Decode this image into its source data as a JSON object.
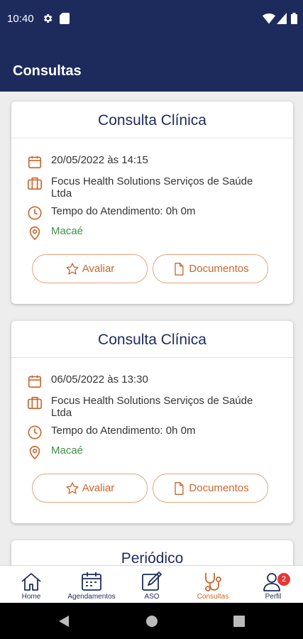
{
  "status_bar": {
    "time": "10:40"
  },
  "app_bar": {
    "title": "Consultas"
  },
  "cards": [
    {
      "title": "Consulta Clínica",
      "date": "20/05/2022 às 14:15",
      "company": "Focus Health Solutions Serviços de Saúde Ltda",
      "duration": "Tempo do Atendimento: 0h 0m",
      "location": "Macaé",
      "rate_label": "Avaliar",
      "documents_label": "Documentos"
    },
    {
      "title": "Consulta Clínica",
      "date": "06/05/2022 às 13:30",
      "company": "Focus Health Solutions Serviços de Saúde Ltda",
      "duration": "Tempo do Atendimento: 0h 0m",
      "location": "Macaé",
      "rate_label": "Avaliar",
      "documents_label": "Documentos"
    },
    {
      "title": "Periódico"
    }
  ],
  "bottom_nav": {
    "items": [
      {
        "label": "Home",
        "icon": "home-icon"
      },
      {
        "label": "Agendamentos",
        "icon": "calendar-icon"
      },
      {
        "label": "ASO",
        "icon": "edit-document-icon"
      },
      {
        "label": "Consultas",
        "icon": "stethoscope-icon",
        "active": true
      },
      {
        "label": "Perfil",
        "icon": "profile-icon",
        "badge": "2"
      }
    ]
  },
  "colors": {
    "primary": "#1d2b5c",
    "accent": "#c9672e",
    "location": "#3f8f4a",
    "badge": "#e53935"
  }
}
